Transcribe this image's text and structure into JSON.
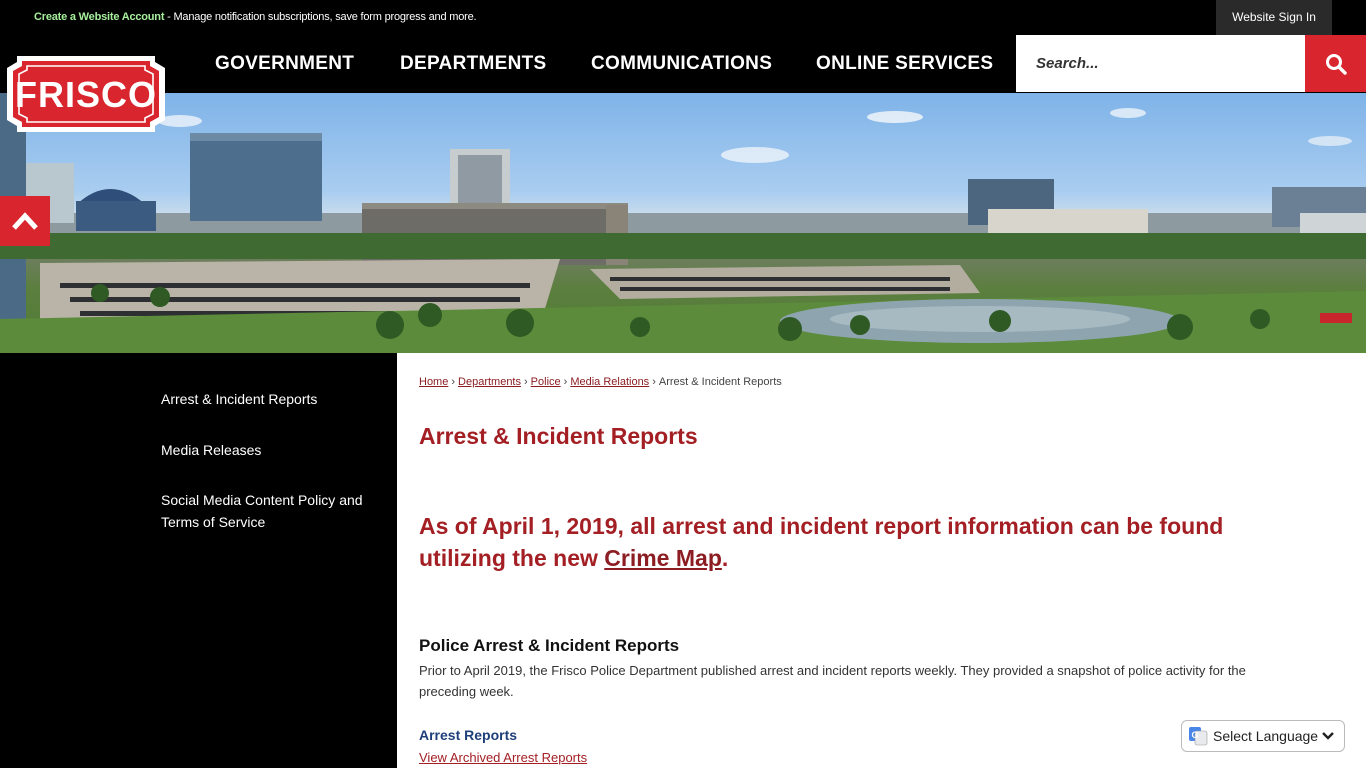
{
  "utility": {
    "account_link": "Create a Website Account",
    "account_text": " - Manage notification subscriptions, save form progress and more.",
    "sign_in": "Website Sign In"
  },
  "logo": {
    "text": "FRISCO"
  },
  "nav": {
    "items": [
      {
        "label": "GOVERNMENT"
      },
      {
        "label": "DEPARTMENTS"
      },
      {
        "label": "COMMUNICATIONS"
      },
      {
        "label": "ONLINE SERVICES"
      }
    ]
  },
  "search": {
    "placeholder": "Search...",
    "icon": "search-icon"
  },
  "sidebar": {
    "items": [
      {
        "label": "Arrest & Incident Reports"
      },
      {
        "label": "Media Releases"
      },
      {
        "label": "Social Media Content Policy and Terms of Service"
      }
    ]
  },
  "breadcrumb": {
    "home": "Home",
    "departments": "Departments",
    "police": "Police",
    "media_relations": "Media Relations",
    "current": "Arrest & Incident Reports",
    "separator": "›"
  },
  "main": {
    "title": "Arrest & Incident Reports",
    "notice_before": "As of April 1, 2019, all arrest and incident report information can be found utilizing the new ",
    "notice_link": "Crime Map",
    "notice_after": ".",
    "section_title": "Police Arrest & Incident Reports",
    "section_body": "Prior to April 2019, the Frisco Police Department published arrest and incident reports weekly.  They provided a snapshot of police activity for the preceding week.",
    "arrest_title": "Arrest Reports",
    "archive_link": "View Archived Arrest Reports"
  },
  "language": {
    "label": "Select Language"
  },
  "colors": {
    "brand_red": "#d9262e",
    "title_red": "#a31f24",
    "link_blue": "#1f3f7a"
  }
}
